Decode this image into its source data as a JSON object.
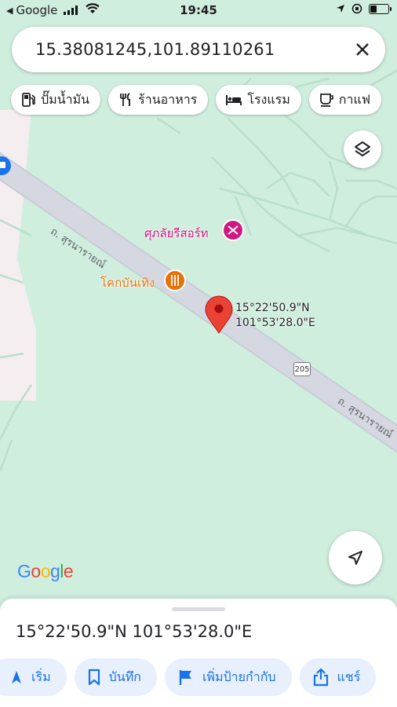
{
  "status_bar": {
    "back_label": "◀",
    "carrier": "Google",
    "time": "19:45"
  },
  "search": {
    "query": "15.38081245,101.89110261",
    "close_icon": "close-icon"
  },
  "chips": [
    {
      "icon": "gas-station-icon",
      "label": "ปั๊มน้ำมัน"
    },
    {
      "icon": "restaurant-icon",
      "label": "ร้านอาหาร"
    },
    {
      "icon": "hotel-icon",
      "label": "โรงแรม"
    },
    {
      "icon": "cafe-icon",
      "label": "กาแฟ"
    }
  ],
  "map": {
    "road_labels": [
      "ถ. สุรนารายณ์",
      "ถ. สุรนารายณ์"
    ],
    "route_number": "205",
    "pois": [
      {
        "name": "ศุภลัยรีสอร์ท",
        "color": "#d01884",
        "icon": "spa-icon"
      },
      {
        "name": "โคกบันเทิง",
        "color": "#e8710a",
        "icon": "restaurant-icon"
      }
    ],
    "pin_coords_line1": "15°22'50.9\"N",
    "pin_coords_line2": "101°53'28.0\"E",
    "pin_color": "#ea4335",
    "logo": "Google"
  },
  "sheet": {
    "title": "15°22'50.9\"N 101°53'28.0\"E",
    "actions": [
      {
        "icon": "directions-icon",
        "label": "เริ่ม"
      },
      {
        "icon": "bookmark-icon",
        "label": "บันทึก"
      },
      {
        "icon": "flag-icon",
        "label": "เพิ่มป้ายกำกับ"
      },
      {
        "icon": "share-icon",
        "label": "แชร์"
      }
    ]
  },
  "colors": {
    "map_bg": "#cfeedd",
    "road": "#c8ccd6",
    "accent": "#1a73e8"
  }
}
